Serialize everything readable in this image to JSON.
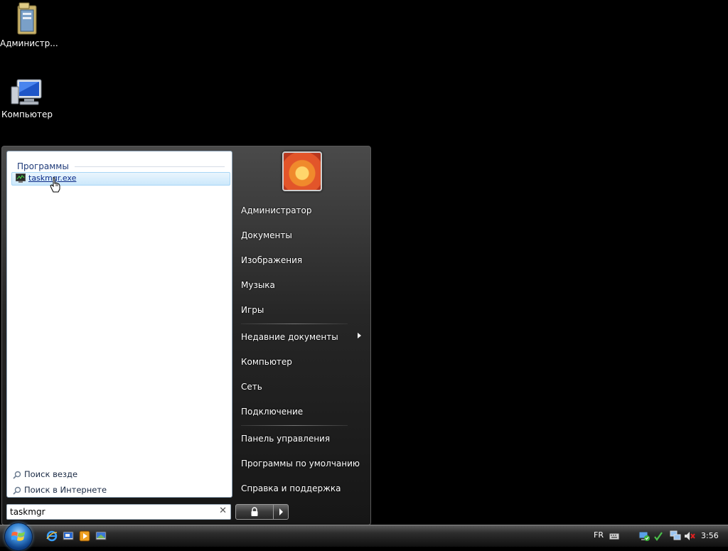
{
  "desktop": {
    "icons": [
      {
        "label": "Администр..."
      },
      {
        "label": "Компьютер"
      }
    ]
  },
  "start_menu": {
    "left_pane": {
      "group_header": "Программы",
      "results": [
        {
          "label": "taskmgr.exe"
        }
      ],
      "search_links": [
        {
          "label": "Поиск везде"
        },
        {
          "label": "Поиск в Интернете"
        }
      ]
    },
    "search_box": {
      "value": "taskmgr"
    },
    "right_pane": {
      "items": [
        {
          "label": "Администратор"
        },
        {
          "label": "Документы"
        },
        {
          "label": "Изображения"
        },
        {
          "label": "Музыка"
        },
        {
          "label": "Игры"
        },
        {
          "label": "Недавние документы"
        },
        {
          "label": "Компьютер"
        },
        {
          "label": "Сеть"
        },
        {
          "label": "Подключение"
        },
        {
          "label": "Панель управления"
        },
        {
          "label": "Программы по умолчанию"
        },
        {
          "label": "Справка и поддержка"
        }
      ]
    }
  },
  "taskbar": {
    "quick_launch": [
      {
        "icon": "internet-explorer-icon"
      },
      {
        "icon": "show-desktop-icon"
      },
      {
        "icon": "media-player-icon"
      },
      {
        "icon": "switch-windows-icon"
      }
    ],
    "tray": {
      "language": "FR",
      "clock": "3:56"
    }
  },
  "colors": {
    "desktop_bg": "#000000",
    "highlight": "#cbe8fb",
    "link_blue": "#0b2a88"
  }
}
